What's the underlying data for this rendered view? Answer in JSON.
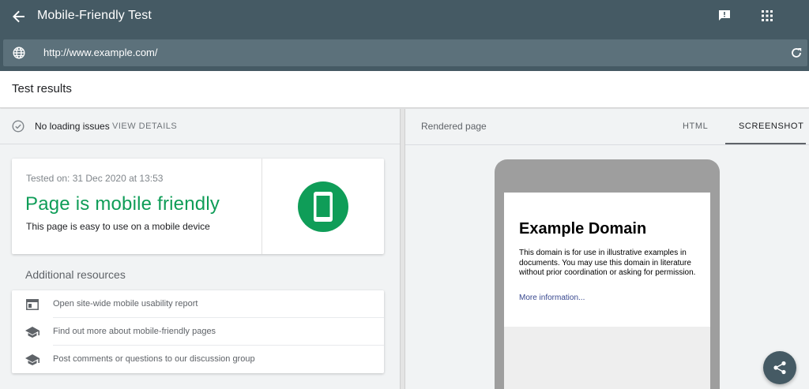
{
  "appbar": {
    "title": "Mobile-Friendly Test",
    "icons": {
      "back": "arrow-back-icon",
      "feedback": "feedback-icon",
      "apps": "apps-grid-icon"
    },
    "url": "http://www.example.com/"
  },
  "results": {
    "heading": "Test results"
  },
  "status": {
    "message": "No loading issues",
    "view_details": "VIEW DETAILS"
  },
  "summary": {
    "tested_on": "Tested on: 31 Dec 2020 at 13:53",
    "verdict": "Page is mobile friendly",
    "description": "This page is easy to use on a mobile device",
    "accent_color": "#0f9d58"
  },
  "additional": {
    "heading": "Additional resources",
    "items": [
      {
        "label": "Open site-wide mobile usability report",
        "icon": "web-report-icon"
      },
      {
        "label": "Find out more about mobile-friendly pages",
        "icon": "school-icon"
      },
      {
        "label": "Post comments or questions to our discussion group",
        "icon": "school-icon"
      }
    ]
  },
  "rendered": {
    "label": "Rendered page",
    "tabs": [
      {
        "label": "HTML"
      },
      {
        "label": "SCREENSHOT",
        "active": true
      }
    ],
    "preview": {
      "title": "Example Domain",
      "text": "This domain is for use in illustrative examples in documents. You may use this domain in literature without prior coordination or asking for permission.",
      "link": "More information..."
    }
  },
  "theme": {
    "appbar": "#455a64",
    "urlbar": "#5c717b"
  }
}
